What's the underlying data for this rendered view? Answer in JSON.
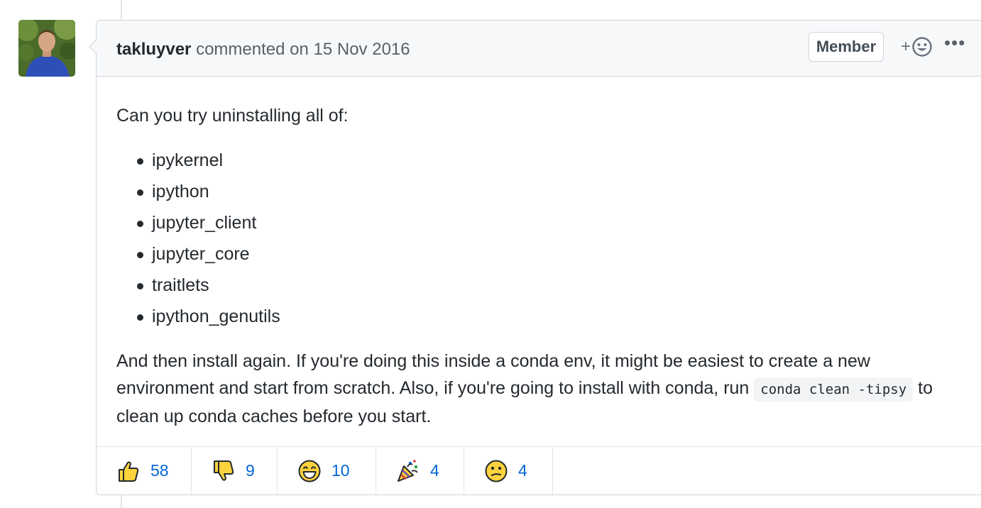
{
  "comment": {
    "author": "takluyver",
    "action_text": "commented on",
    "date": "15 Nov 2016",
    "role_badge": "Member",
    "add_reaction_plus": "+",
    "more_menu": "•••",
    "avatar_icon": "user-avatar-photo"
  },
  "body": {
    "intro": "Can you try uninstalling all of:",
    "packages": [
      "ipykernel",
      "ipython",
      "jupyter_client",
      "jupyter_core",
      "traitlets",
      "ipython_genutils"
    ],
    "outro_before_code": "And then install again. If you're doing this inside a conda env, it might be easiest to create a new environment and start from scratch. Also, if you're going to install with conda, run ",
    "code": "conda clean -tipsy",
    "outro_after_code": " to clean up conda caches before you start."
  },
  "reactions": [
    {
      "icon": "thumbs-up-icon",
      "count": "58"
    },
    {
      "icon": "thumbs-down-icon",
      "count": "9"
    },
    {
      "icon": "laugh-icon",
      "count": "10"
    },
    {
      "icon": "hooray-icon",
      "count": "4"
    },
    {
      "icon": "confused-icon",
      "count": "4"
    }
  ],
  "colors": {
    "header_bg": "#f6f8fa",
    "border": "#d1d5da",
    "link_blue": "#0366d6",
    "emoji_yellow": "#ffd33d",
    "emoji_outline": "#24292e"
  }
}
